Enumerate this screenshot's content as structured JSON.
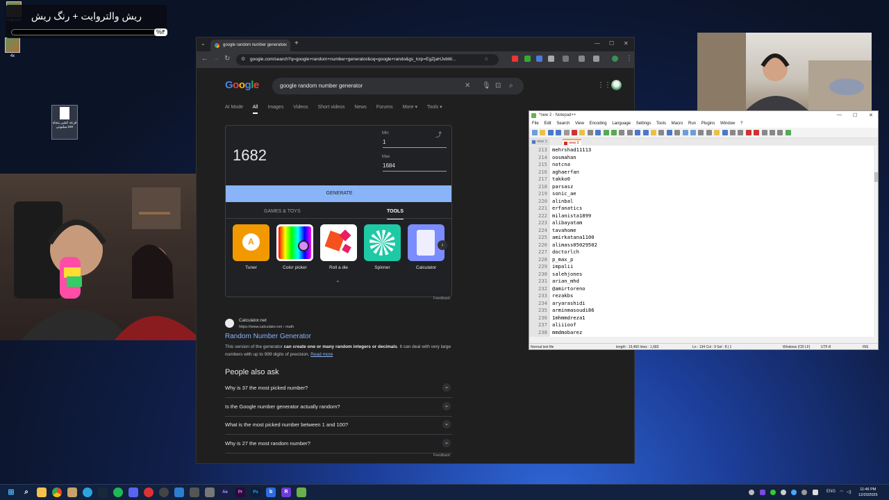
{
  "overlay": {
    "title": "ریش والتروایت + رنگ ریش",
    "percent": "%۴"
  },
  "desktop": {
    "icons": [
      {
        "label": "ccgt-last"
      },
      {
        "label": "4x"
      }
    ],
    "csv_file": {
      "label": "قرعه کشی پنجاه میلیونی.csv"
    }
  },
  "chrome": {
    "tab_title": "google random number generator",
    "url": "google.com/search?q=google+random+number+generator&oq=google+rando&gs_lcrp=EgZjaHJvbW...",
    "search_query": "google random number generator",
    "logo": "Google",
    "search_tabs": [
      "AI Mode",
      "All",
      "Images",
      "Videos",
      "Short videos",
      "News",
      "Forums",
      "More ▾",
      "Tools ▾"
    ],
    "rng": {
      "result": "1682",
      "min_label": "Min",
      "min_value": "1",
      "max_label": "Max",
      "max_value": "1684",
      "generate_label": "GENERATE",
      "tab_games": "GAMES & TOYS",
      "tab_tools": "TOOLS",
      "tools": [
        {
          "label": "Tuner",
          "color": "#f29900"
        },
        {
          "label": "Color picker",
          "color": "#ffffff"
        },
        {
          "label": "Roll a die",
          "color": "#ffffff"
        },
        {
          "label": "Spinner",
          "color": "#1ec9a6"
        },
        {
          "label": "Calculator",
          "color": "#7b8cff"
        }
      ],
      "tuner_glyph": "A",
      "feedback": "Feedback"
    },
    "result": {
      "site": "Calculator.net",
      "url": "https://www.calculator.net › math",
      "title": "Random Number Generator",
      "snippet_pre": "This version of the generator",
      "snippet_bold": "can create one or many random integers or decimals",
      "snippet_post": ". It can deal with very large numbers with up to 999 digits of precision.",
      "read_more": "Read more"
    },
    "paa": {
      "title": "People also ask",
      "questions": [
        "Why is 37 the most picked number?",
        "Is the Google number generator actually random?",
        "What is the most picked number between 1 and 100?",
        "Why is 27 the most random number?"
      ],
      "feedback": "Feedback"
    }
  },
  "notepad": {
    "title": "*new 2 - Notepad++",
    "menu": [
      "File",
      "Edit",
      "Search",
      "View",
      "Encoding",
      "Language",
      "Settings",
      "Tools",
      "Macro",
      "Run",
      "Plugins",
      "Window",
      "?"
    ],
    "tabs": [
      "new 1",
      "new 2"
    ],
    "lines": [
      {
        "n": "213",
        "t": "mehrshad11113"
      },
      {
        "n": "214",
        "t": "oosmahan"
      },
      {
        "n": "215",
        "t": "notcna"
      },
      {
        "n": "216",
        "t": "aghaerfan"
      },
      {
        "n": "217",
        "t": "takko0"
      },
      {
        "n": "218",
        "t": "parsasz"
      },
      {
        "n": "219",
        "t": "sonic_ae"
      },
      {
        "n": "220",
        "t": "alinbal"
      },
      {
        "n": "221",
        "t": "erfanatics"
      },
      {
        "n": "222",
        "t": "milanista1899"
      },
      {
        "n": "223",
        "t": "alibayatam"
      },
      {
        "n": "224",
        "t": "tavahome"
      },
      {
        "n": "225",
        "t": "amirkatana1100"
      },
      {
        "n": "226",
        "t": "alimass05029502"
      },
      {
        "n": "227",
        "t": "doctorlch"
      },
      {
        "n": "228",
        "t": "p_max_p"
      },
      {
        "n": "229",
        "t": "impalii"
      },
      {
        "n": "230",
        "t": "salehjones"
      },
      {
        "n": "231",
        "t": "arian_mhd"
      },
      {
        "n": "232",
        "t": "@amirtoreno"
      },
      {
        "n": "233",
        "t": "rezakbs"
      },
      {
        "n": "234",
        "t": "aryarashidi"
      },
      {
        "n": "235",
        "t": "arminmasoudi86"
      },
      {
        "n": "236",
        "t": "1mhmmdreza1"
      },
      {
        "n": "237",
        "t": "aliiioof"
      },
      {
        "n": "238",
        "t": "mmdmobarez"
      }
    ],
    "status": {
      "type": "Normal text file",
      "length": "length : 19,460    lines : 1,683",
      "pos": "Ln : 134    Col : 9    Sel : 8 | 1",
      "eol": "Windows (CR LF)",
      "enc": "UTF-8",
      "mode": "INS"
    }
  },
  "taskbar": {
    "lang": "ENG",
    "time": "11:46 PM",
    "date": "12/20/2025"
  }
}
